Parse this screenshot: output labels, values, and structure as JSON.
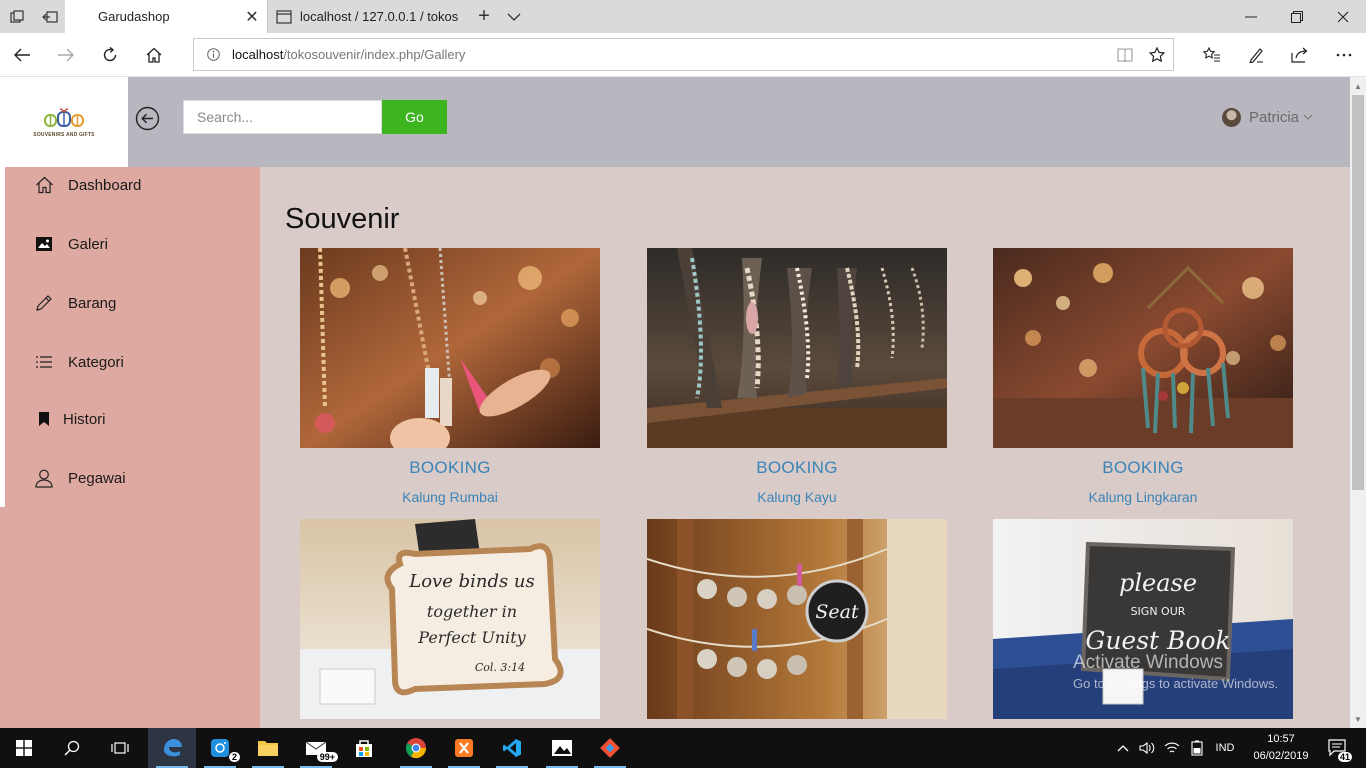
{
  "browser": {
    "tabs": [
      {
        "title": "Garudashop",
        "active": true
      },
      {
        "title": "localhost / 127.0.0.1 / tokos",
        "active": false
      }
    ],
    "address": {
      "host": "localhost",
      "path": "/tokosouvenir/index.php/Gallery"
    }
  },
  "topbar": {
    "logo_text": "SOUVENIRS AND GIFTS",
    "search_placeholder": "Search...",
    "go_label": "Go",
    "user_name": "Patricia"
  },
  "sidebar": {
    "items": [
      {
        "label": "Dashboard",
        "icon": "home-icon"
      },
      {
        "label": "Galeri",
        "icon": "image-icon"
      },
      {
        "label": "Barang",
        "icon": "pencil-icon"
      },
      {
        "label": "Kategori",
        "icon": "list-icon"
      },
      {
        "label": "Histori",
        "icon": "bookmark-icon"
      },
      {
        "label": "Pegawai",
        "icon": "user-icon"
      }
    ]
  },
  "main": {
    "title": "Souvenir",
    "products": [
      {
        "booking": "BOOKING",
        "name": "Kalung Rumbai"
      },
      {
        "booking": "BOOKING",
        "name": "Kalung Kayu"
      },
      {
        "booking": "BOOKING",
        "name": "Kalung Lingkaran"
      },
      {
        "image_text": "Love binds us together in Perfect Unity Col. 3:14"
      },
      {
        "image_text": "Seat"
      },
      {
        "image_text": "please sign our Guest Book"
      }
    ]
  },
  "watermark": {
    "line1": "Activate Windows",
    "line2": "Go to Settings to activate Windows."
  },
  "taskbar": {
    "badges": {
      "instagram": "2",
      "mail": "99+"
    },
    "tray": {
      "language": "IND",
      "time": "10:57",
      "date": "06/02/2019",
      "notifications": "41"
    }
  },
  "colors": {
    "sidebar": "#dea9a0",
    "topbar": "#b8b6be",
    "content": "#d9ccc8",
    "go_button": "#3cb521",
    "link": "#3b84b8"
  }
}
